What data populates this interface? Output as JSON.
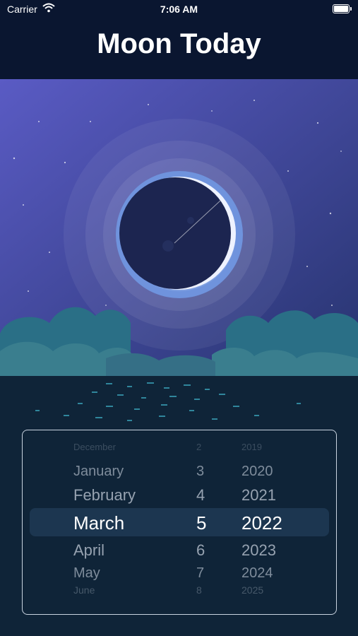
{
  "status_bar": {
    "carrier": "Carrier",
    "time": "7:06 AM",
    "wifi_icon": "wifi-icon",
    "battery_icon": "battery-icon"
  },
  "header": {
    "title": "Moon Today"
  },
  "colors": {
    "header_bg": "#0a1630",
    "sky_top": "#5a5bc4",
    "sky_bottom": "#27346f",
    "moon_ring": "#6f93dd",
    "cloud": "#3a7e8e",
    "water": "#0f2438"
  },
  "picker": {
    "rows": [
      {
        "month": "December",
        "day": "2",
        "year": "2019"
      },
      {
        "month": "January",
        "day": "3",
        "year": "2020"
      },
      {
        "month": "February",
        "day": "4",
        "year": "2021"
      },
      {
        "month": "March",
        "day": "5",
        "year": "2022"
      },
      {
        "month": "April",
        "day": "6",
        "year": "2023"
      },
      {
        "month": "May",
        "day": "7",
        "year": "2024"
      },
      {
        "month": "June",
        "day": "8",
        "year": "2025"
      }
    ]
  }
}
